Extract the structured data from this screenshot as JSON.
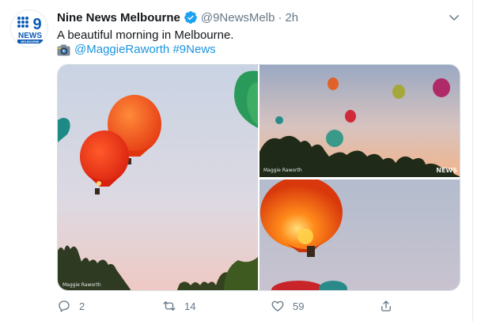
{
  "account": {
    "display_name": "Nine News Melbourne",
    "handle": "@9NewsMelb",
    "separator": "·",
    "time": "2h",
    "verified": true,
    "avatar_logo_text": "NEWS",
    "avatar_logo_subtext": "MELBOURNE"
  },
  "tweet": {
    "text": "A beautiful morning in Melbourne.",
    "credit_icon": "camera-icon",
    "mention": "@MaggieRaworth",
    "hashtag": "#9News"
  },
  "media": {
    "photo_credit": "Maggie Raworth",
    "photo_logo": "NEWS"
  },
  "actions": {
    "reply_count": "2",
    "retweet_count": "14",
    "like_count": "59"
  },
  "colors": {
    "link": "#1b95e0",
    "verified": "#1da1f2",
    "muted": "#657786",
    "brand_blue": "#0050a0"
  }
}
